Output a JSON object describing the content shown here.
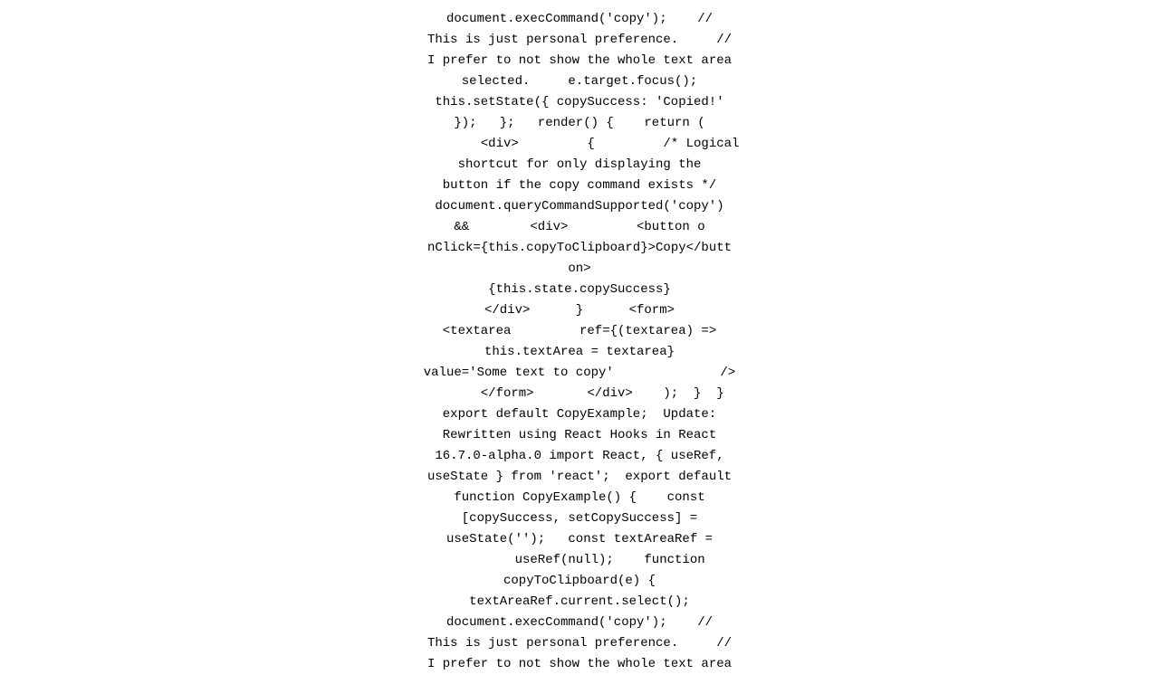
{
  "code": {
    "lines": [
      "document.execCommand('copy');    //",
      "This is just personal preference.     //",
      "I prefer to not show the whole text area",
      "selected.     e.target.focus();",
      "this.setState({ copySuccess: 'Copied!'",
      "});   };   render() {    return (",
      "        <div>         {         /* Logical",
      "shortcut for only displaying the",
      "button if the copy command exists */",
      "document.queryCommandSupported('copy')",
      "&&        <div>         <button o",
      "nClick={this.copyToClipboard}>Copy</butt",
      "on>",
      "{this.state.copySuccess}",
      "</div>      }      <form>",
      "<textarea         ref={(textarea) =>",
      "this.textArea = textarea}",
      "value='Some text to copy'              />",
      "      </form>       </div>    );  }  }",
      "export default CopyExample;  Update:",
      "Rewritten using React Hooks in React",
      "16.7.0-alpha.0 import React, { useRef,",
      "useState } from 'react';  export default",
      "function CopyExample() {    const",
      "[copySuccess, setCopySuccess] =",
      "useState('');   const textAreaRef =",
      "        useRef(null);    function",
      "copyToClipboard(e) {",
      "textAreaRef.current.select();",
      "document.execCommand('copy');    //",
      "This is just personal preference.     //",
      "I prefer to not show the whole text area"
    ]
  }
}
